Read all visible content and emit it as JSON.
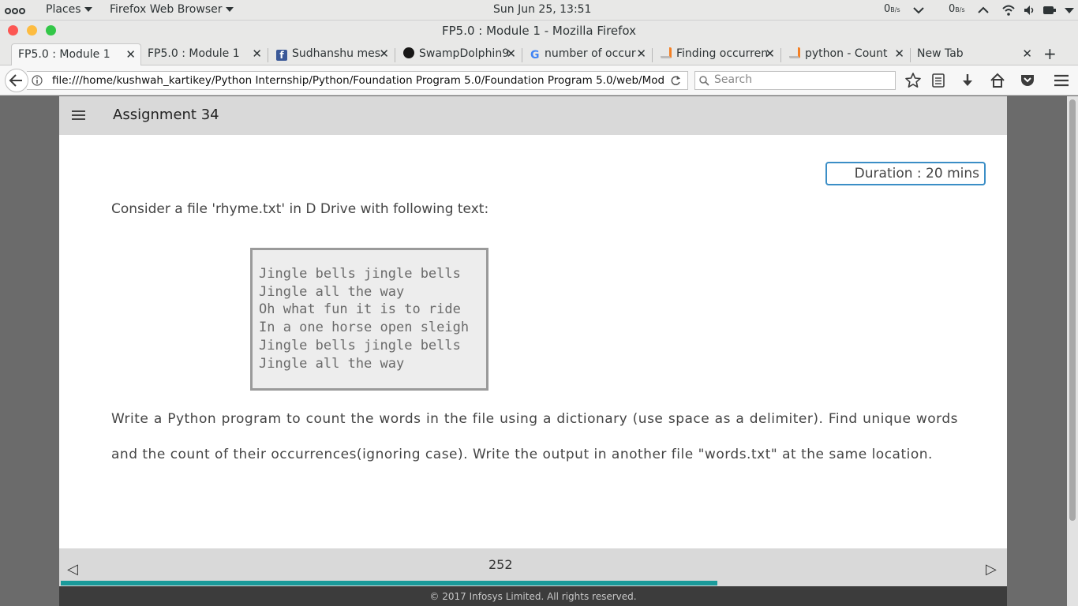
{
  "system_panel": {
    "places": "Places",
    "app_menu": "Firefox Web Browser",
    "clock": "Sun Jun 25, 13:51",
    "net_down_value": "0",
    "net_down_unit": "B/s",
    "net_up_value": "0",
    "net_up_unit": "B/s"
  },
  "window": {
    "title": "FP5.0 : Module 1 - Mozilla Firefox"
  },
  "tabs": [
    {
      "label": "FP5.0 : Module 1",
      "icon": "none",
      "active": true
    },
    {
      "label": "FP5.0 : Module 1",
      "icon": "none",
      "active": false
    },
    {
      "label": "Sudhanshu mes",
      "icon": "facebook-icon",
      "active": false
    },
    {
      "label": "SwampDolphin9",
      "icon": "github-icon",
      "active": false
    },
    {
      "label": "number of occur",
      "icon": "google-icon",
      "active": false
    },
    {
      "label": "Finding occurren",
      "icon": "stackoverflow-icon",
      "active": false
    },
    {
      "label": "python - Count",
      "icon": "stackoverflow-icon",
      "active": false
    },
    {
      "label": "New Tab",
      "icon": "none",
      "active": false
    }
  ],
  "navbar": {
    "url": "file:///home/kushwah_kartikey/Python Internship/Python/Foundation Program 5.0/Foundation Program 5.0/web/Mod",
    "search_placeholder": "Search"
  },
  "page": {
    "title": "Assignment 34",
    "duration": "Duration : 20 mins",
    "intro": "Consider a file 'rhyme.txt' in D Drive with following text:",
    "rhyme_lines": [
      "Jingle bells jingle bells",
      "Jingle all the way",
      "Oh what fun it is to ride",
      "In a one horse open sleigh",
      "Jingle bells jingle bells",
      "Jingle all the way"
    ],
    "question": "Write a Python program to count the words in the file using a dictionary (use space as a delimiter). Find unique words and the count of their occurrences(ignoring case). Write the output in another file \"words.txt\" at the same location.",
    "page_number": "252",
    "progress_fraction": 0.695,
    "footer": "© 2017 Infosys Limited. All rights reserved."
  },
  "colors": {
    "accent_teal": "#1a9a9a",
    "duration_border": "#3b8ec6",
    "close_red": "#fc5753",
    "minimize_yellow": "#fdbc40",
    "maximize_green": "#33c748"
  }
}
